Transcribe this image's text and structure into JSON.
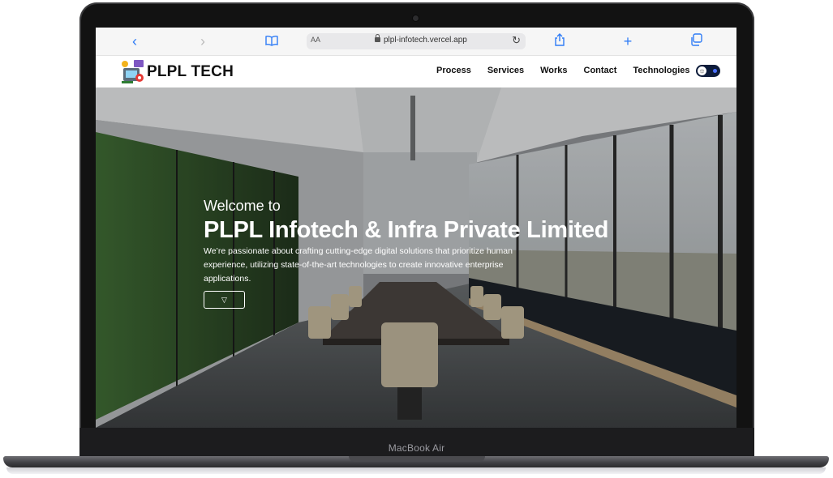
{
  "device": {
    "label": "MacBook Air"
  },
  "browser": {
    "text_size_label": "AA",
    "url": "plpl-infotech.vercel.app",
    "icons": [
      "back-icon",
      "forward-icon",
      "bookmarks-icon",
      "reload-icon",
      "share-icon",
      "new-tab-icon",
      "tabs-icon"
    ]
  },
  "site": {
    "logo_text": "PLPL TECH",
    "nav": [
      "Process",
      "Services",
      "Works",
      "Contact",
      "Technologies"
    ],
    "theme_toggle_icon": "sun-icon"
  },
  "hero": {
    "welcome": "Welcome to",
    "title": "PLPL Infotech & Infra Private Limited",
    "description": "We’re passionate about crafting cutting-edge digital solutions that prioritize human experience, utilizing state-of-the-art technologies to create innovative enterprise applications.",
    "cta_icon": "chevron-down-icon",
    "cta_glyph": "▽"
  },
  "colors": {
    "browser_accent": "#2f7cf6",
    "toggle_bg": "#0d1b3a",
    "laptop_body": "#121212"
  }
}
